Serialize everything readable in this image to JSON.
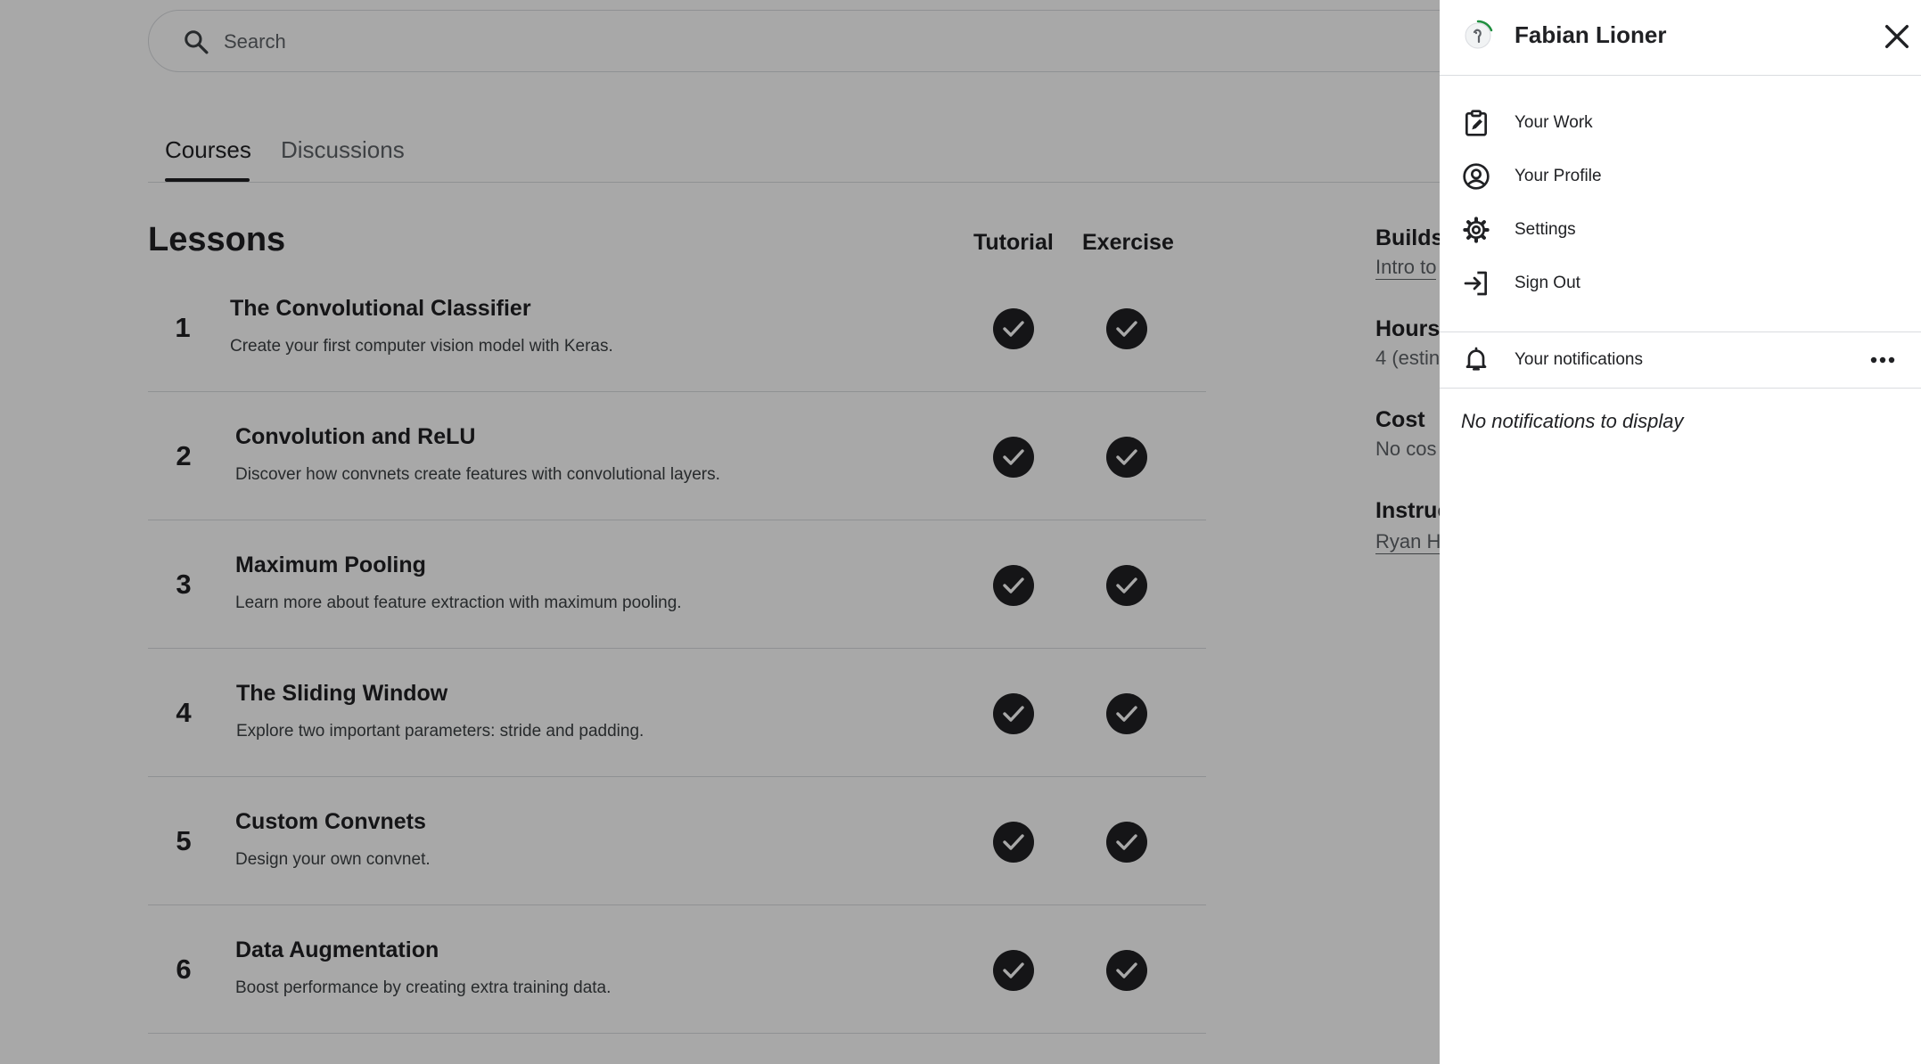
{
  "search": {
    "placeholder": "Search"
  },
  "tabs": [
    {
      "label": "Courses"
    },
    {
      "label": "Discussions"
    }
  ],
  "lessons": {
    "heading": "Lessons",
    "col_tutorial": "Tutorial",
    "col_exercise": "Exercise",
    "items": [
      {
        "num": "1",
        "title": "The Convolutional Classifier",
        "desc": "Create your first computer vision model with Keras."
      },
      {
        "num": "2",
        "title": "Convolution and ReLU",
        "desc": "Discover how convnets create features with convolutional layers."
      },
      {
        "num": "3",
        "title": "Maximum Pooling",
        "desc": "Learn more about feature extraction with maximum pooling."
      },
      {
        "num": "4",
        "title": "The Sliding Window",
        "desc": "Explore two important parameters: stride and padding."
      },
      {
        "num": "5",
        "title": "Custom Convnets",
        "desc": "Design your own convnet."
      },
      {
        "num": "6",
        "title": "Data Augmentation",
        "desc": "Boost performance by creating extra training data."
      }
    ]
  },
  "info": {
    "builds_label": "Builds",
    "builds_value": "Intro to",
    "hours_label": "Hours",
    "hours_value": "4 (estin",
    "cost_label": "Cost",
    "cost_value": "No cos",
    "instructor_label": "Instruc",
    "instructor_value": "Ryan H"
  },
  "panel": {
    "user_name": "Fabian Lioner",
    "menu": [
      {
        "label": "Your Work",
        "icon": "clipboard-edit-icon"
      },
      {
        "label": "Your Profile",
        "icon": "user-circle-icon"
      },
      {
        "label": "Settings",
        "icon": "gear-icon"
      },
      {
        "label": "Sign Out",
        "icon": "sign-out-icon"
      }
    ],
    "notifications_label": "Your notifications",
    "empty_text": "No notifications to display"
  },
  "colors": {
    "overlay": "#000000",
    "text": "#202124",
    "progress_ring": "#20beff"
  }
}
